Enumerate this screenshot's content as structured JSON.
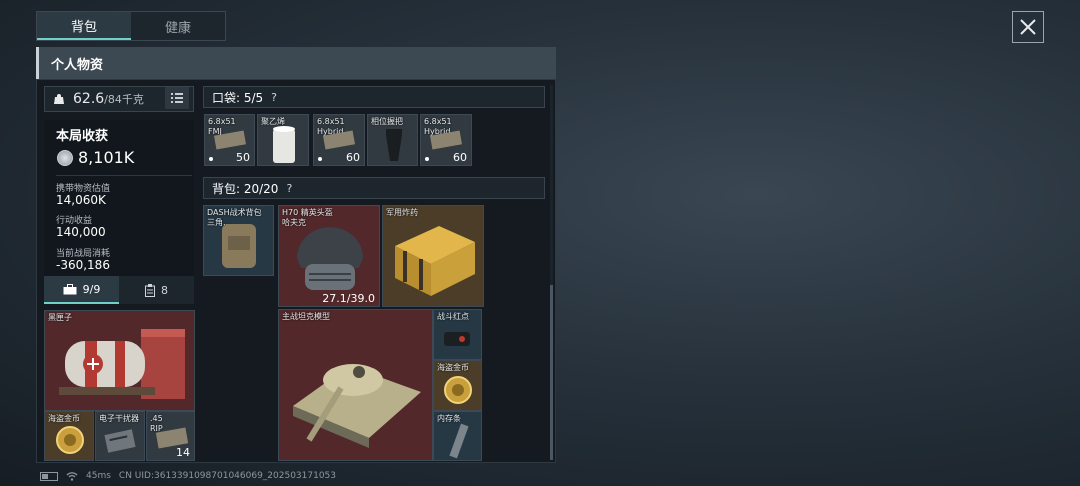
{
  "tabs": {
    "backpack": "背包",
    "health": "健康"
  },
  "header": {
    "title": "个人物资"
  },
  "weight": {
    "current": "62.6",
    "max": "/84千克"
  },
  "loot": {
    "title": "本局收获",
    "value": "8,101K"
  },
  "stats": [
    {
      "label": "携带物资估值",
      "value": "14,060K"
    },
    {
      "label": "行动收益",
      "value": "140,000"
    },
    {
      "label": "当前战局消耗",
      "value": "-360,186"
    }
  ],
  "subtabs": {
    "case_count": "9/9",
    "other_count": "8"
  },
  "pocket": {
    "title": "口袋:  5/5",
    "help": "?"
  },
  "backpack": {
    "title": "背包:  20/20",
    "help": "?"
  },
  "pocket_items": [
    {
      "name": "6.8x51\nFMJ",
      "count": "50"
    },
    {
      "name": "聚乙烯",
      "count": ""
    },
    {
      "name": "6.8x51\nHybrid",
      "count": "60"
    },
    {
      "name": "相位握把",
      "count": ""
    },
    {
      "name": "6.8x51\nHybrid",
      "count": "60"
    }
  ],
  "bag_items": [
    {
      "name": "DASH战术背包\n三角..."
    },
    {
      "name": "H70 精英头盔\n哈夫克",
      "count": "27.1/39.0"
    },
    {
      "name": "军用炸药"
    },
    {
      "name": "主战坦克模型"
    },
    {
      "name": "战斗红点"
    },
    {
      "name": "海盗金币"
    },
    {
      "name": "内存条"
    }
  ],
  "case_items": [
    {
      "name": "黑匣子"
    },
    {
      "name": "海盗金币"
    },
    {
      "name": "电子干扰器"
    },
    {
      "name": ".45\nRIP",
      "count": "14"
    }
  ],
  "status": {
    "ping": "45ms",
    "uid": "CN UID:3613391098701046069_202503171053"
  },
  "colors": {
    "accent": "#6fd1c7",
    "red_cell": "#52282b",
    "gold_cell": "#4b3d28",
    "blue_cell": "#253844"
  }
}
